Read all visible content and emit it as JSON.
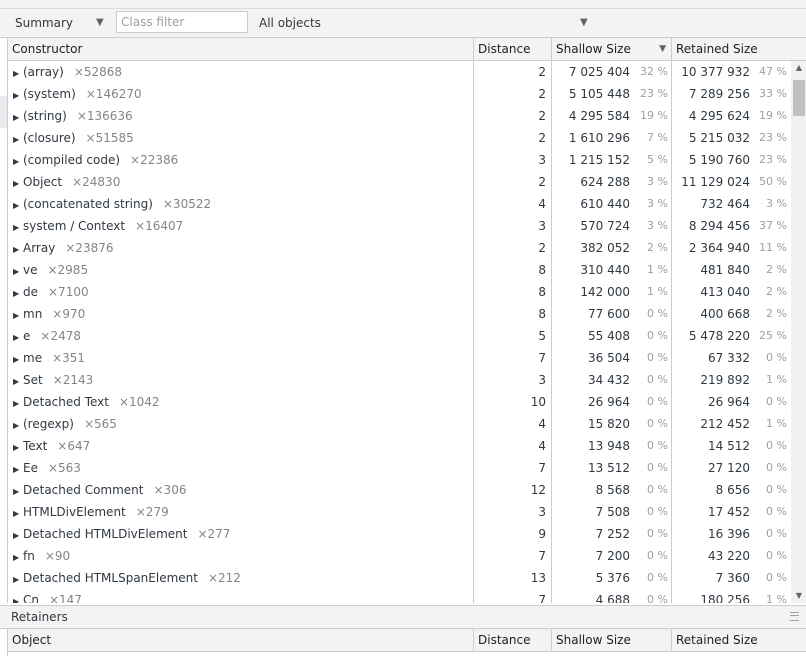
{
  "toolbar": {
    "view_select": "Summary",
    "class_filter_placeholder": "Class filter",
    "object_select": "All objects"
  },
  "grid": {
    "columns": [
      "Constructor",
      "Distance",
      "Shallow Size",
      "Retained Size"
    ],
    "sorted_column": "Shallow Size",
    "rows": [
      {
        "name": "(array)",
        "count": "×52868",
        "distance": "2",
        "shallow": "7 025 404",
        "shallow_pct": "32 %",
        "retained": "10 377 932",
        "retained_pct": "47 %"
      },
      {
        "name": "(system)",
        "count": "×146270",
        "distance": "2",
        "shallow": "5 105 448",
        "shallow_pct": "23 %",
        "retained": "7 289 256",
        "retained_pct": "33 %"
      },
      {
        "name": "(string)",
        "count": "×136636",
        "distance": "2",
        "shallow": "4 295 584",
        "shallow_pct": "19 %",
        "retained": "4 295 624",
        "retained_pct": "19 %"
      },
      {
        "name": "(closure)",
        "count": "×51585",
        "distance": "2",
        "shallow": "1 610 296",
        "shallow_pct": "7 %",
        "retained": "5 215 032",
        "retained_pct": "23 %"
      },
      {
        "name": "(compiled code)",
        "count": "×22386",
        "distance": "3",
        "shallow": "1 215 152",
        "shallow_pct": "5 %",
        "retained": "5 190 760",
        "retained_pct": "23 %"
      },
      {
        "name": "Object",
        "count": "×24830",
        "distance": "2",
        "shallow": "624 288",
        "shallow_pct": "3 %",
        "retained": "11 129 024",
        "retained_pct": "50 %"
      },
      {
        "name": "(concatenated string)",
        "count": "×30522",
        "distance": "4",
        "shallow": "610 440",
        "shallow_pct": "3 %",
        "retained": "732 464",
        "retained_pct": "3 %"
      },
      {
        "name": "system / Context",
        "count": "×16407",
        "distance": "3",
        "shallow": "570 724",
        "shallow_pct": "3 %",
        "retained": "8 294 456",
        "retained_pct": "37 %"
      },
      {
        "name": "Array",
        "count": "×23876",
        "distance": "2",
        "shallow": "382 052",
        "shallow_pct": "2 %",
        "retained": "2 364 940",
        "retained_pct": "11 %"
      },
      {
        "name": "ve",
        "count": "×2985",
        "distance": "8",
        "shallow": "310 440",
        "shallow_pct": "1 %",
        "retained": "481 840",
        "retained_pct": "2 %"
      },
      {
        "name": "de",
        "count": "×7100",
        "distance": "8",
        "shallow": "142 000",
        "shallow_pct": "1 %",
        "retained": "413 040",
        "retained_pct": "2 %"
      },
      {
        "name": "mn",
        "count": "×970",
        "distance": "8",
        "shallow": "77 600",
        "shallow_pct": "0 %",
        "retained": "400 668",
        "retained_pct": "2 %"
      },
      {
        "name": "e",
        "count": "×2478",
        "distance": "5",
        "shallow": "55 408",
        "shallow_pct": "0 %",
        "retained": "5 478 220",
        "retained_pct": "25 %"
      },
      {
        "name": "me",
        "count": "×351",
        "distance": "7",
        "shallow": "36 504",
        "shallow_pct": "0 %",
        "retained": "67 332",
        "retained_pct": "0 %"
      },
      {
        "name": "Set",
        "count": "×2143",
        "distance": "3",
        "shallow": "34 432",
        "shallow_pct": "0 %",
        "retained": "219 892",
        "retained_pct": "1 %"
      },
      {
        "name": "Detached Text",
        "count": "×1042",
        "distance": "10",
        "shallow": "26 964",
        "shallow_pct": "0 %",
        "retained": "26 964",
        "retained_pct": "0 %"
      },
      {
        "name": "(regexp)",
        "count": "×565",
        "distance": "4",
        "shallow": "15 820",
        "shallow_pct": "0 %",
        "retained": "212 452",
        "retained_pct": "1 %"
      },
      {
        "name": "Text",
        "count": "×647",
        "distance": "4",
        "shallow": "13 948",
        "shallow_pct": "0 %",
        "retained": "14 512",
        "retained_pct": "0 %"
      },
      {
        "name": "Ee",
        "count": "×563",
        "distance": "7",
        "shallow": "13 512",
        "shallow_pct": "0 %",
        "retained": "27 120",
        "retained_pct": "0 %"
      },
      {
        "name": "Detached Comment",
        "count": "×306",
        "distance": "12",
        "shallow": "8 568",
        "shallow_pct": "0 %",
        "retained": "8 656",
        "retained_pct": "0 %"
      },
      {
        "name": "HTMLDivElement",
        "count": "×279",
        "distance": "3",
        "shallow": "7 508",
        "shallow_pct": "0 %",
        "retained": "17 452",
        "retained_pct": "0 %"
      },
      {
        "name": "Detached HTMLDivElement",
        "count": "×277",
        "distance": "9",
        "shallow": "7 252",
        "shallow_pct": "0 %",
        "retained": "16 396",
        "retained_pct": "0 %"
      },
      {
        "name": "fn",
        "count": "×90",
        "distance": "7",
        "shallow": "7 200",
        "shallow_pct": "0 %",
        "retained": "43 220",
        "retained_pct": "0 %"
      },
      {
        "name": "Detached HTMLSpanElement",
        "count": "×212",
        "distance": "13",
        "shallow": "5 376",
        "shallow_pct": "0 %",
        "retained": "7 360",
        "retained_pct": "0 %"
      },
      {
        "name": "Cn",
        "count": "×147",
        "distance": "7",
        "shallow": "4 688",
        "shallow_pct": "0 %",
        "retained": "180 256",
        "retained_pct": "1 %"
      }
    ]
  },
  "retainers": {
    "title": "Retainers",
    "columns": [
      "Object",
      "Distance",
      "Shallow Size",
      "Retained Size"
    ]
  },
  "icons": {
    "expand": "triangle-right-icon",
    "dropdown": "dropdown-arrow-icon",
    "sort": "sort-descending-icon"
  }
}
